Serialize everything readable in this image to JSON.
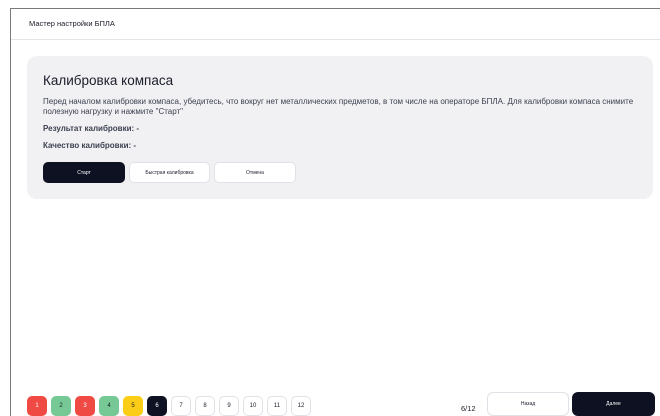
{
  "window": {
    "title": "Мастер настройки БПЛА"
  },
  "calibration": {
    "heading": "Калибровка компаса",
    "description": "Перед началом калибровки компаса, убедитесь, что вокруг нет металлических предметов, в том числе на операторе БПЛА. Для калибровки компаса снимите полезную нагрузку и нажмите \"Старт\"",
    "result": "Результат калибровки: -",
    "quality": "Качество калибровки: -",
    "start_label": "Старт",
    "quick_label": "Быстрая калибровка",
    "cancel_label": "Отмена"
  },
  "steps": [
    {
      "label": "1",
      "status": "error"
    },
    {
      "label": "2",
      "status": "done"
    },
    {
      "label": "3",
      "status": "error"
    },
    {
      "label": "4",
      "status": "done"
    },
    {
      "label": "5",
      "status": "warning"
    },
    {
      "label": "6",
      "status": "current"
    },
    {
      "label": "7",
      "status": "pending"
    },
    {
      "label": "8",
      "status": "pending"
    },
    {
      "label": "9",
      "status": "pending"
    },
    {
      "label": "10",
      "status": "pending"
    },
    {
      "label": "11",
      "status": "pending"
    },
    {
      "label": "12",
      "status": "pending"
    }
  ],
  "footer": {
    "counter": "6/12",
    "back_label": "Назад",
    "next_label": "Далее"
  },
  "colors": {
    "error": "#ef4b44",
    "done": "#76c994",
    "warning": "#fbcd16",
    "current": "#0d1121",
    "accent": "#0d1121"
  }
}
